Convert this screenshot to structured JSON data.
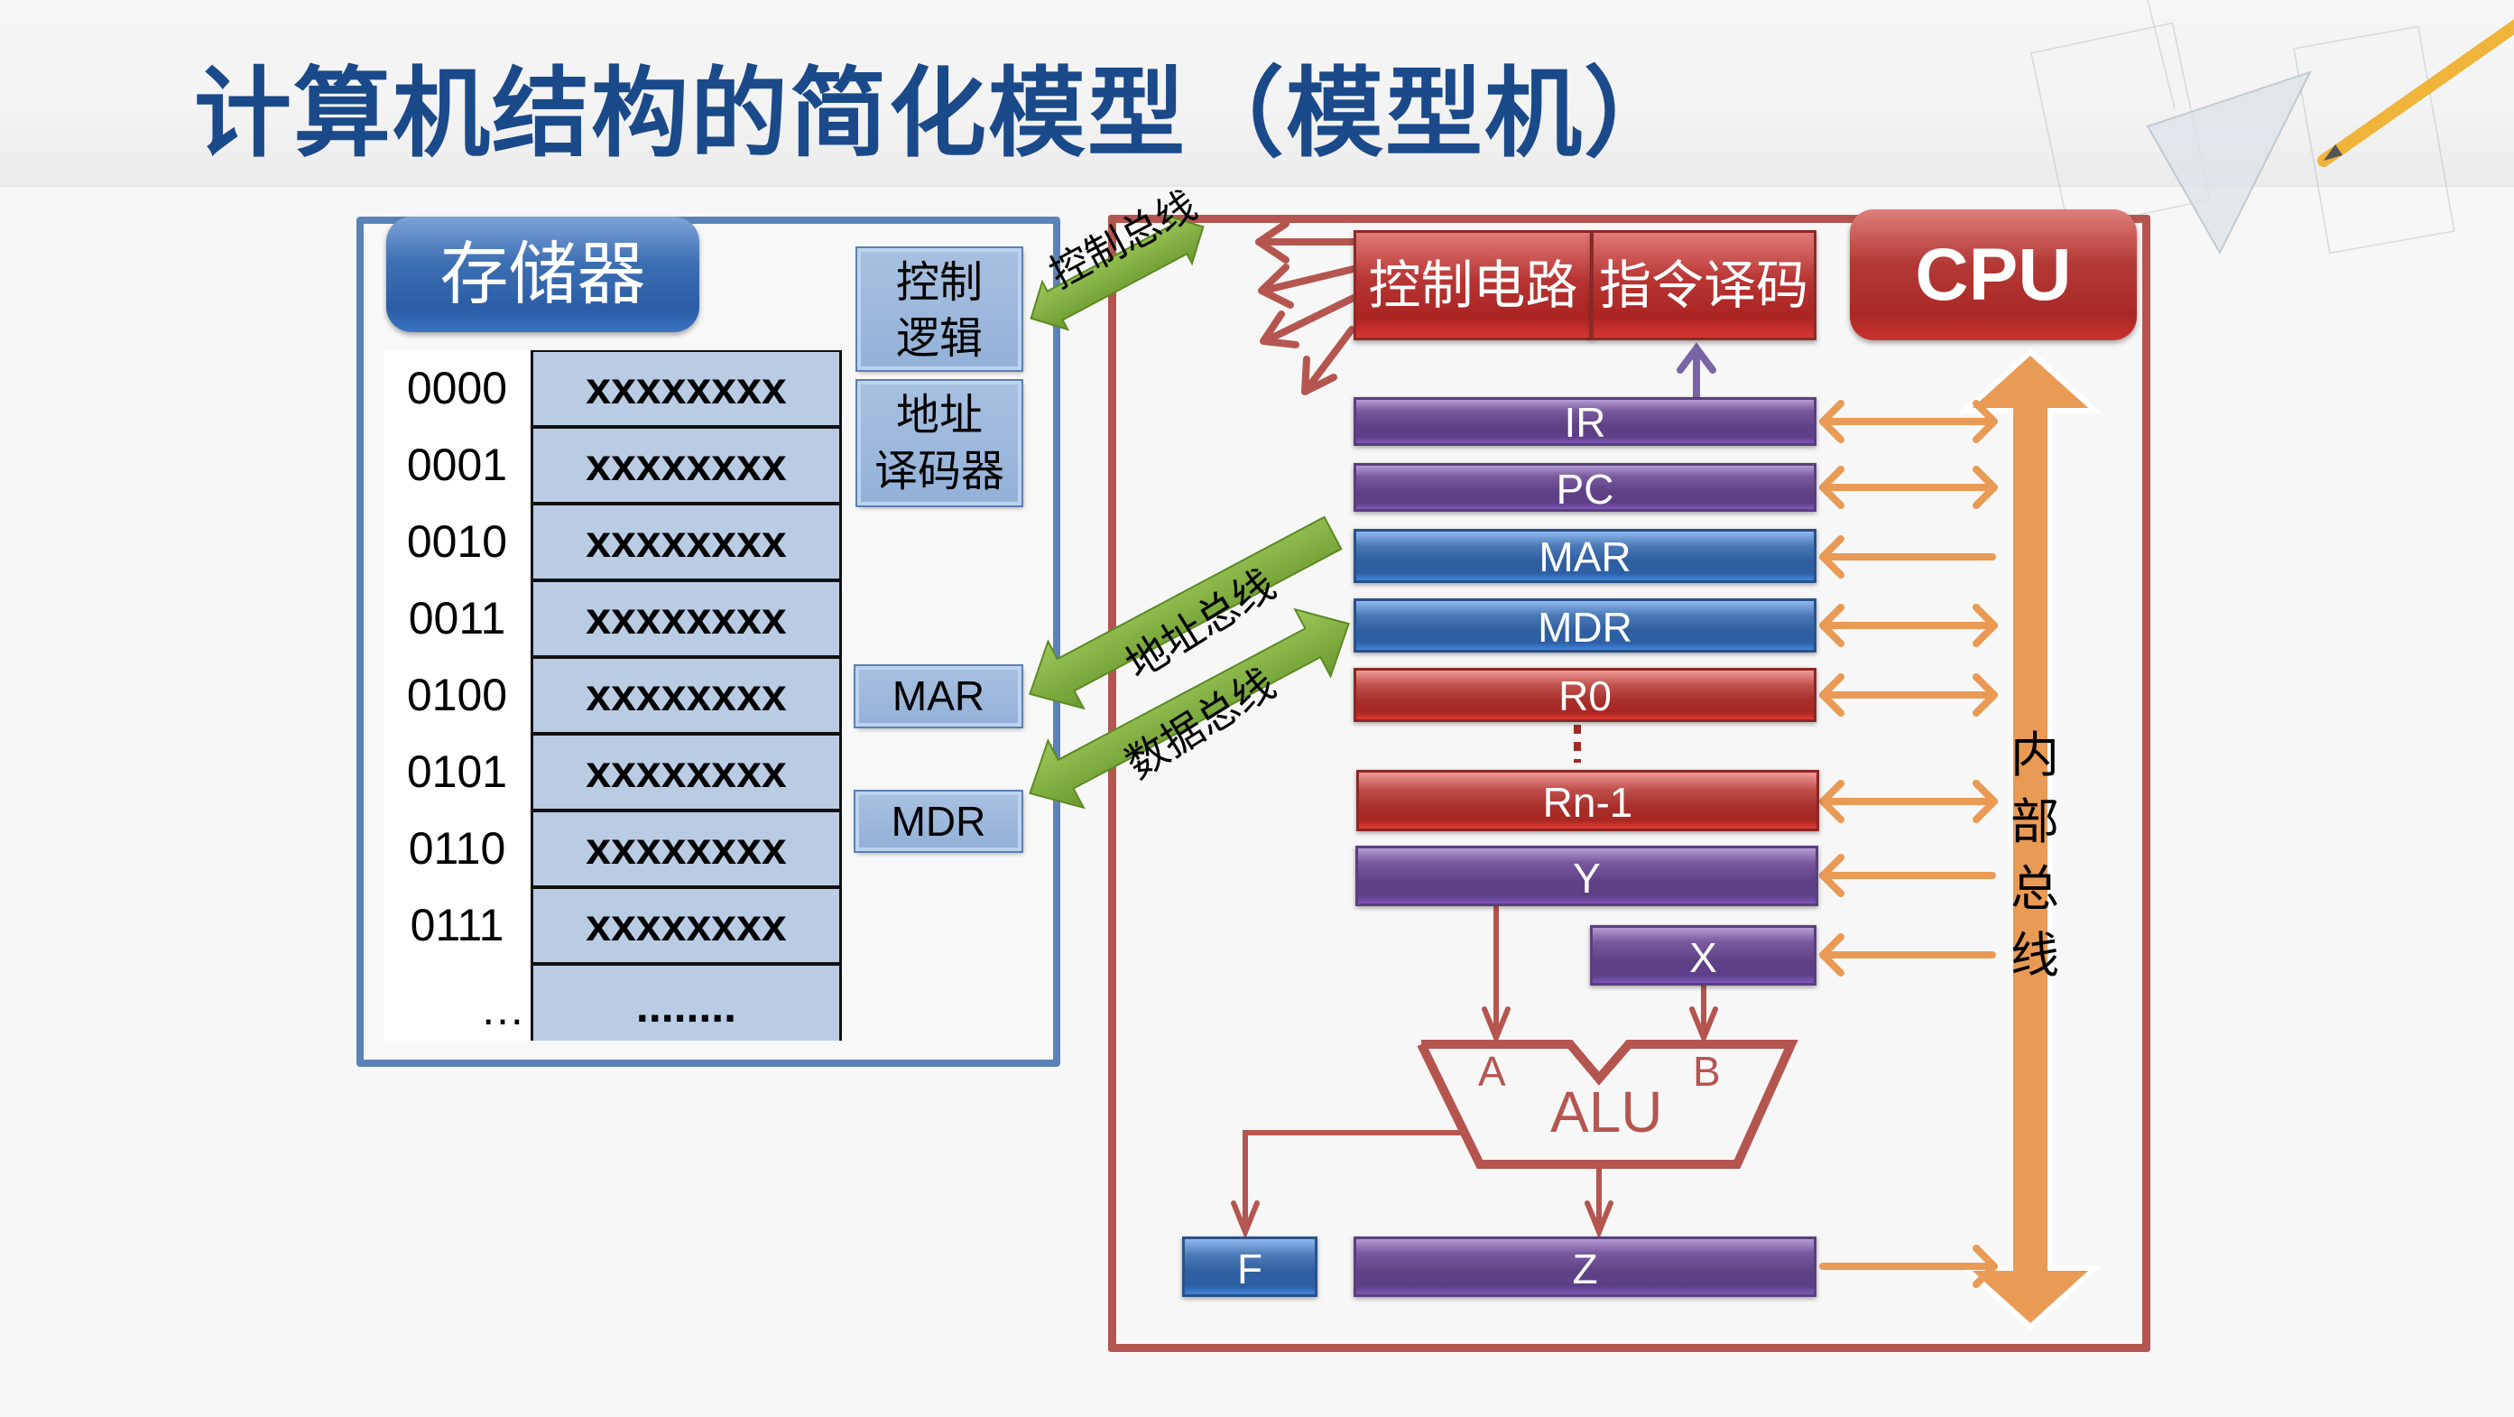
{
  "title": "计算机结构的简化模型（模型机）",
  "memory": {
    "label": "存储器",
    "rows": [
      {
        "address": "0000",
        "data": "xxxxxxxx"
      },
      {
        "address": "0001",
        "data": "xxxxxxxx"
      },
      {
        "address": "0010",
        "data": "xxxxxxxx"
      },
      {
        "address": "0011",
        "data": "xxxxxxxx"
      },
      {
        "address": "0100",
        "data": "xxxxxxxx"
      },
      {
        "address": "0101",
        "data": "xxxxxxxx"
      },
      {
        "address": "0110",
        "data": "xxxxxxxx"
      },
      {
        "address": "0111",
        "data": "xxxxxxxx"
      },
      {
        "address": "…",
        "data": "........"
      }
    ],
    "control_logic_line1": "控制",
    "control_logic_line2": "逻辑",
    "addr_decoder_line1": "地址",
    "addr_decoder_line2": "译码器",
    "mar": "MAR",
    "mdr": "MDR"
  },
  "buses": {
    "control": "控制总线",
    "address": "地址总线",
    "data": "数据总线",
    "internal_chars": [
      "内",
      "部",
      "总",
      "线"
    ]
  },
  "cpu": {
    "label": "CPU",
    "control_circuit": "控制电路",
    "instruction_decode": "指令译码",
    "registers": {
      "ir": "IR",
      "pc": "PC",
      "mar": "MAR",
      "mdr": "MDR",
      "r0": "R0",
      "rn1": "Rn-1",
      "y": "Y",
      "x": "X",
      "f": "F",
      "z": "Z"
    },
    "alu": {
      "label": "ALU",
      "input_a": "A",
      "input_b": "B"
    }
  },
  "colors": {
    "title": "#1a4a8a",
    "memory_border": "#5b82b8",
    "cpu_border": "#b5554f",
    "bus_green": "#78a83a",
    "internal_bus": "#e99a55",
    "register_purple": "#5f4186",
    "register_blue": "#2f5fa0",
    "register_red": "#a8302c"
  }
}
